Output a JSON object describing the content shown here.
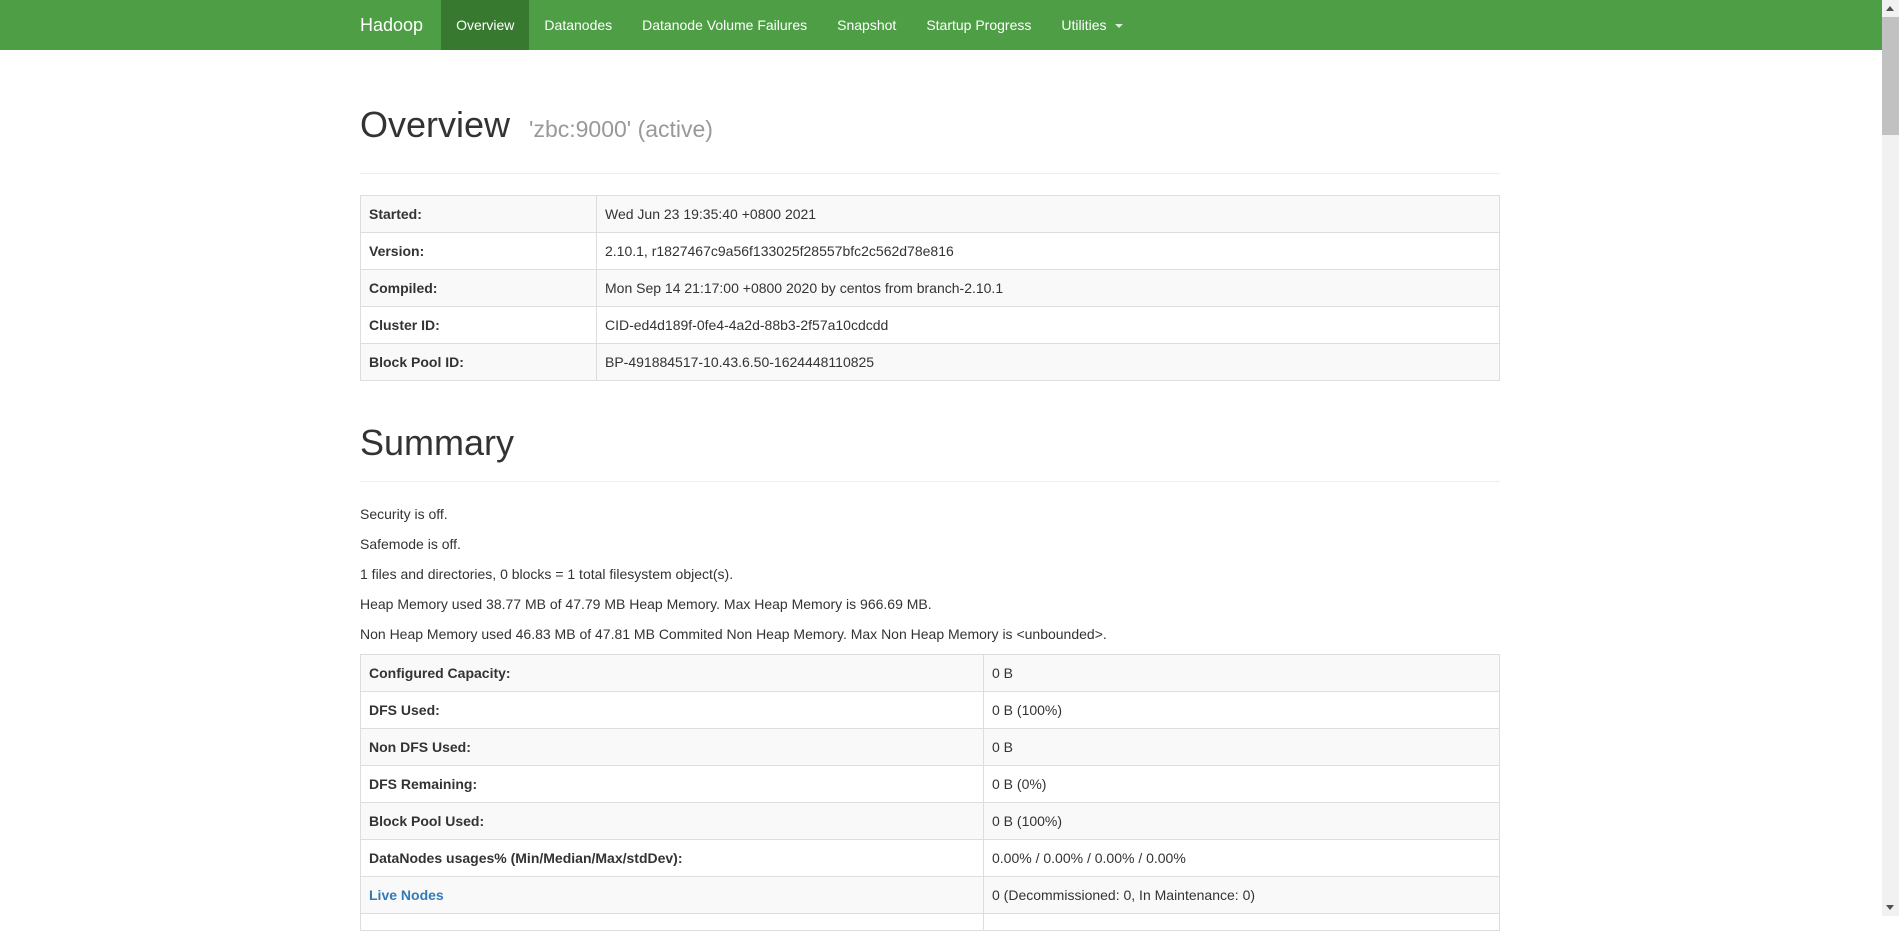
{
  "navbar": {
    "brand": "Hadoop",
    "items": [
      {
        "label": "Overview",
        "active": true
      },
      {
        "label": "Datanodes"
      },
      {
        "label": "Datanode Volume Failures"
      },
      {
        "label": "Snapshot"
      },
      {
        "label": "Startup Progress"
      },
      {
        "label": "Utilities",
        "dropdown": true
      }
    ]
  },
  "overview": {
    "title": "Overview",
    "subtitle": "'zbc:9000' (active)",
    "rows": [
      {
        "label": "Started:",
        "value": "Wed Jun 23 19:35:40 +0800 2021"
      },
      {
        "label": "Version:",
        "value": "2.10.1, r1827467c9a56f133025f28557bfc2c562d78e816"
      },
      {
        "label": "Compiled:",
        "value": "Mon Sep 14 21:17:00 +0800 2020 by centos from branch-2.10.1"
      },
      {
        "label": "Cluster ID:",
        "value": "CID-ed4d189f-0fe4-4a2d-88b3-2f57a10cdcdd"
      },
      {
        "label": "Block Pool ID:",
        "value": "BP-491884517-10.43.6.50-1624448110825"
      }
    ]
  },
  "summary": {
    "title": "Summary",
    "paragraphs": [
      "Security is off.",
      "Safemode is off.",
      "1 files and directories, 0 blocks = 1 total filesystem object(s).",
      "Heap Memory used 38.77 MB of 47.79 MB Heap Memory. Max Heap Memory is 966.69 MB.",
      "Non Heap Memory used 46.83 MB of 47.81 MB Commited Non Heap Memory. Max Non Heap Memory is <unbounded>."
    ],
    "rows": [
      {
        "label": "Configured Capacity:",
        "value": "0 B"
      },
      {
        "label": "DFS Used:",
        "value": "0 B (100%)"
      },
      {
        "label": "Non DFS Used:",
        "value": "0 B"
      },
      {
        "label": "DFS Remaining:",
        "value": "0 B (0%)"
      },
      {
        "label": "Block Pool Used:",
        "value": "0 B (100%)"
      },
      {
        "label": "DataNodes usages% (Min/Median/Max/stdDev):",
        "value": "0.00% / 0.00% / 0.00% / 0.00%"
      },
      {
        "label": "Live Nodes",
        "value": "0 (Decommissioned: 0, In Maintenance: 0)",
        "link": true
      },
      {
        "label": "",
        "value": ""
      }
    ]
  },
  "colors": {
    "navbar_green": "#4D9E45",
    "active_green": "#377A2F",
    "link_blue": "#337AB7",
    "stripe_gray": "#F9F9F9",
    "border_gray": "#DDDDDD"
  }
}
